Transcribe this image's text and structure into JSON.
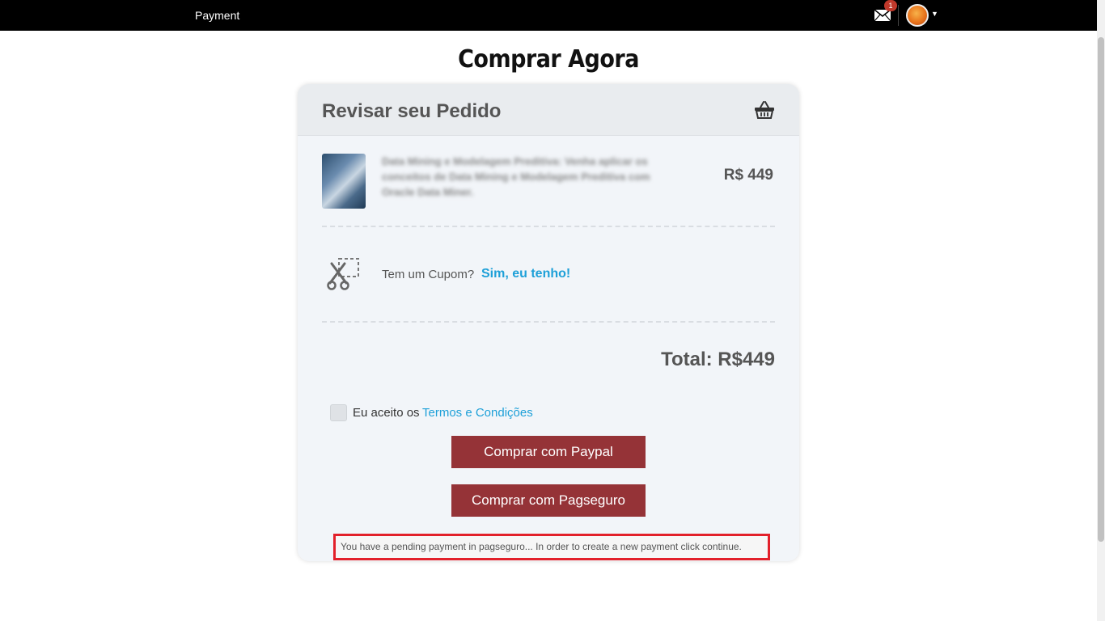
{
  "topbar": {
    "title": "Payment",
    "mail_badge": "1"
  },
  "page": {
    "heading": "Comprar Agora"
  },
  "order": {
    "header": "Revisar seu Pedido",
    "product_text": "Data Mining e Modelagem Preditiva: Venha aplicar os conceitos de Data Mining e Modelagem Preditiva com Oracle Data Miner.",
    "price": "R$ 449",
    "coupon_question": "Tem um Cupom?",
    "coupon_link": "Sim, eu tenho!",
    "total": "Total: R$449",
    "terms_label": "Eu aceito os",
    "terms_link": "Termos e Condições",
    "paypal_button": "Comprar com Paypal",
    "pagseguro_button": "Comprar com Pagseguro",
    "notice": "You have a pending payment in pagseguro... In order to create a new payment click continue."
  },
  "icons": {
    "mail": "envelope-icon",
    "basket": "basket-icon",
    "coupon": "scissors-coupon-icon",
    "avatar": "user-avatar",
    "dropdown": "caret-down-icon"
  },
  "colors": {
    "topbar": "#000000",
    "button": "#953337",
    "link": "#1ea0d8",
    "notice_border": "#e2202a",
    "badge": "#c0392b"
  }
}
